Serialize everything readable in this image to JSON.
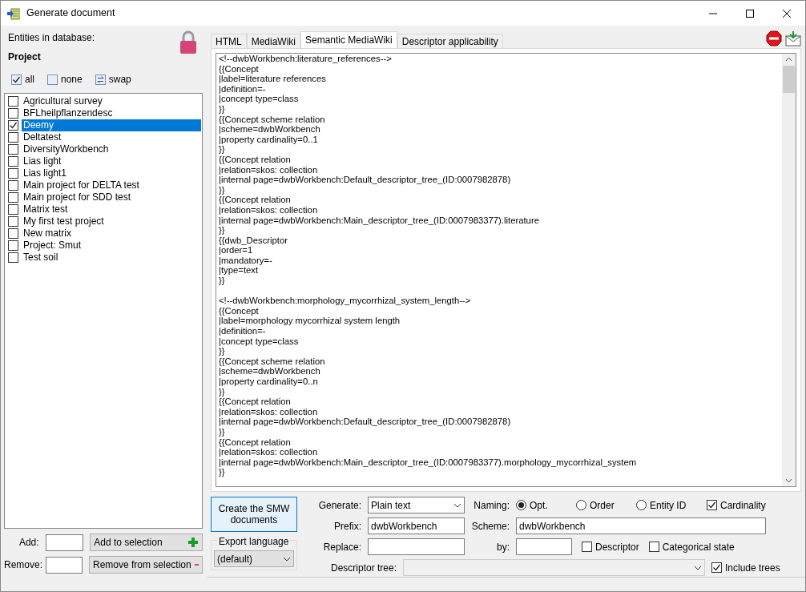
{
  "window": {
    "title": "Generate document"
  },
  "left": {
    "entities_label": "Entities in database:",
    "entity_type": "Project",
    "toggles": [
      {
        "kind": "check",
        "label": "all",
        "checked": true
      },
      {
        "kind": "check",
        "label": "none",
        "checked": false
      },
      {
        "kind": "swap",
        "label": "swap"
      }
    ],
    "items": [
      {
        "label": "Agricultural survey",
        "checked": false,
        "selected": false
      },
      {
        "label": "BFLheilpflanzendesc",
        "checked": false,
        "selected": false
      },
      {
        "label": "Deemy",
        "checked": true,
        "selected": true
      },
      {
        "label": "Deltatest",
        "checked": false,
        "selected": false
      },
      {
        "label": "DiversityWorkbench",
        "checked": false,
        "selected": false
      },
      {
        "label": "Lias light",
        "checked": false,
        "selected": false
      },
      {
        "label": "Lias light1",
        "checked": false,
        "selected": false
      },
      {
        "label": "Main project for DELTA test",
        "checked": false,
        "selected": false
      },
      {
        "label": "Main project for SDD test",
        "checked": false,
        "selected": false
      },
      {
        "label": "Matrix test",
        "checked": false,
        "selected": false
      },
      {
        "label": "My first test project",
        "checked": false,
        "selected": false
      },
      {
        "label": "New matrix",
        "checked": false,
        "selected": false
      },
      {
        "label": "Project: Smut",
        "checked": false,
        "selected": false
      },
      {
        "label": "Test soil",
        "checked": false,
        "selected": false
      }
    ],
    "add_label": "Add:",
    "add_button": "Add to selection",
    "remove_label": "Remove:",
    "remove_button": "Remove from selection"
  },
  "tabs": [
    {
      "label": "HTML",
      "selected": false
    },
    {
      "label": "MediaWiki",
      "selected": false
    },
    {
      "label": "Semantic MediaWiki",
      "selected": true
    },
    {
      "label": "Descriptor applicability",
      "selected": false
    }
  ],
  "document_blocks": [
    [
      "<!--dwbWorkbench:literature_references-->",
      "{{Concept",
      "|label=literature references",
      "|definition=-",
      "|concept type=class",
      "}}",
      "{{Concept scheme relation",
      "|scheme=dwbWorkbench",
      "|property cardinality=0..1",
      "}}",
      "{{Concept relation",
      "|relation=skos: collection",
      "|internal page=dwbWorkbench:Default_descriptor_tree_(ID:0007982878)",
      "}}",
      "{{Concept relation",
      "|relation=skos: collection",
      "|internal page=dwbWorkbench:Main_descriptor_tree_(ID:0007983377).literature",
      "}}",
      "{{dwb_Descriptor",
      "|order=1",
      "|mandatory=-",
      "|type=text",
      "}}"
    ],
    [
      "<!--dwbWorkbench:morphology_mycorrhizal_system_length-->",
      "{{Concept",
      "|label=morphology mycorrhizal system length",
      "|definition=-",
      "|concept type=class",
      "}}",
      "{{Concept scheme relation",
      "|scheme=dwbWorkbench",
      "|property cardinality=0..n",
      "}}",
      "{{Concept relation",
      "|relation=skos: collection",
      "|internal page=dwbWorkbench:Default_descriptor_tree_(ID:0007982878)",
      "}}",
      "{{Concept relation",
      "|relation=skos: collection",
      "|internal page=dwbWorkbench:Main_descriptor_tree_(ID:0007983377).morphology_mycorrhizal_system",
      "}}"
    ]
  ],
  "options": {
    "create_button": "Create the SMW documents",
    "export_language_label": "Export language",
    "export_language": "(default)",
    "generate_label": "Generate:",
    "generate": "Plain text",
    "naming_label": "Naming:",
    "naming": [
      {
        "label": "Opt.",
        "selected": true
      },
      {
        "label": "Order",
        "selected": false
      },
      {
        "label": "Entity ID",
        "selected": false
      }
    ],
    "cardinality": {
      "label": "Cardinality",
      "checked": true
    },
    "prefix_label": "Prefix:",
    "prefix": "dwbWorkbench",
    "scheme_label": "Scheme:",
    "scheme": "dwbWorkbench",
    "replace_label": "Replace:",
    "by_label": "by:",
    "descriptor": {
      "label": "Descriptor",
      "checked": false
    },
    "categorical_state": {
      "label": "Categorical state",
      "checked": false
    },
    "descriptor_tree_label": "Descriptor tree:",
    "include_trees": {
      "label": "Include trees",
      "checked": true
    }
  }
}
